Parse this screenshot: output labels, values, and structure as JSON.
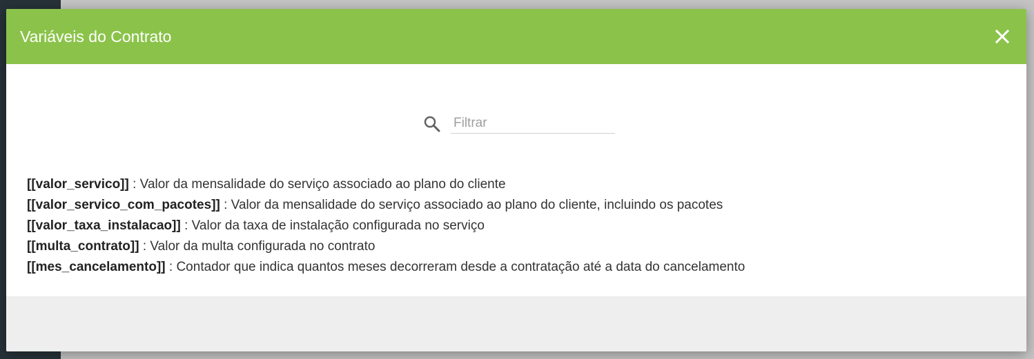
{
  "modal": {
    "title": "Variáveis do Contrato",
    "close_icon": "close-icon",
    "accent_color": "#8bc34a"
  },
  "search": {
    "icon": "search-icon",
    "placeholder": "Filtrar",
    "value": ""
  },
  "variables": [
    {
      "name": "[[valor_servico]]",
      "description": " : Valor da mensalidade do serviço associado ao plano do cliente"
    },
    {
      "name": "[[valor_servico_com_pacotes]]",
      "description": " : Valor da mensalidade do serviço associado ao plano do cliente, incluindo os pacotes"
    },
    {
      "name": "[[valor_taxa_instalacao]]",
      "description": " : Valor da taxa de instalação configurada no serviço"
    },
    {
      "name": "[[multa_contrato]]",
      "description": " : Valor da multa configurada no contrato"
    },
    {
      "name": "[[mes_cancelamento]]",
      "description": " : Contador que indica quantos meses decorreram desde a contratação até a data do cancelamento"
    }
  ]
}
